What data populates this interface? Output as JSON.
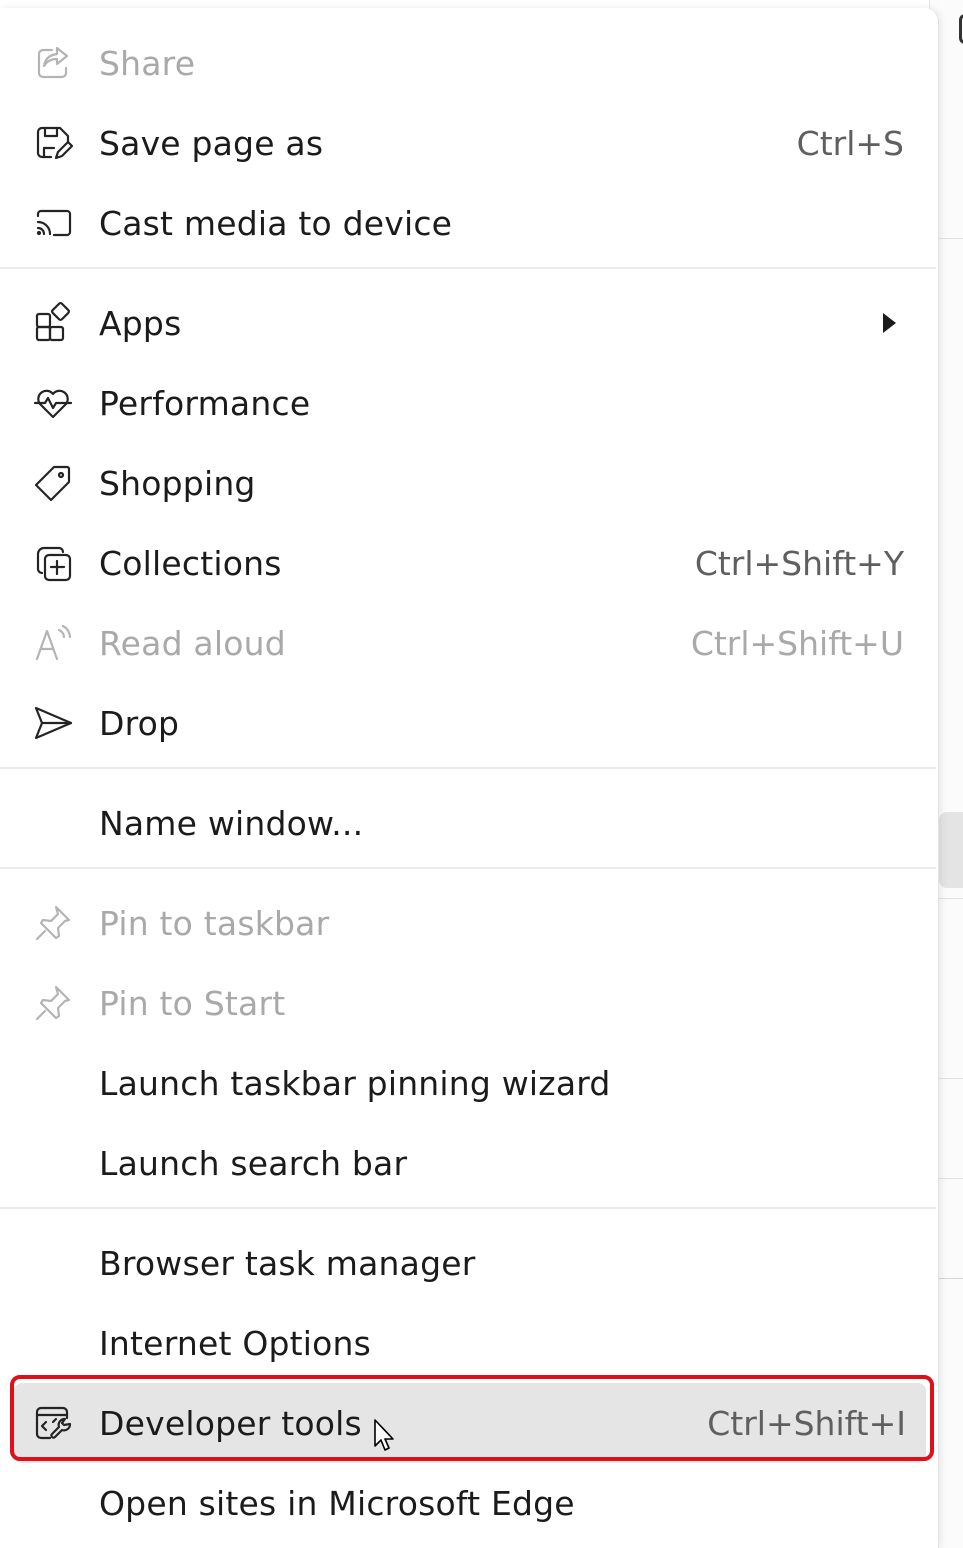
{
  "menu": {
    "items": [
      {
        "id": "share",
        "label": "Share",
        "shortcut": "",
        "icon": "share-icon",
        "disabled": true
      },
      {
        "id": "save-page-as",
        "label": "Save page as",
        "shortcut": "Ctrl+S",
        "icon": "save-icon",
        "disabled": false
      },
      {
        "id": "cast-media",
        "label": "Cast media to device",
        "shortcut": "",
        "icon": "cast-icon",
        "disabled": false
      },
      {
        "id": "apps",
        "label": "Apps",
        "shortcut": "",
        "icon": "apps-icon",
        "disabled": false,
        "submenu": true
      },
      {
        "id": "performance",
        "label": "Performance",
        "shortcut": "",
        "icon": "heartbeat-icon",
        "disabled": false
      },
      {
        "id": "shopping",
        "label": "Shopping",
        "shortcut": "",
        "icon": "tag-icon",
        "disabled": false
      },
      {
        "id": "collections",
        "label": "Collections",
        "shortcut": "Ctrl+Shift+Y",
        "icon": "collections-icon",
        "disabled": false
      },
      {
        "id": "read-aloud",
        "label": "Read aloud",
        "shortcut": "Ctrl+Shift+U",
        "icon": "read-aloud-icon",
        "disabled": true
      },
      {
        "id": "drop",
        "label": "Drop",
        "shortcut": "",
        "icon": "send-icon",
        "disabled": false
      },
      {
        "id": "name-window",
        "label": "Name window...",
        "shortcut": "",
        "icon": "",
        "disabled": false
      },
      {
        "id": "pin-taskbar",
        "label": "Pin to taskbar",
        "shortcut": "",
        "icon": "pin-icon",
        "disabled": true
      },
      {
        "id": "pin-start",
        "label": "Pin to Start",
        "shortcut": "",
        "icon": "pin-icon",
        "disabled": true
      },
      {
        "id": "launch-wizard",
        "label": "Launch taskbar pinning wizard",
        "shortcut": "",
        "icon": "",
        "disabled": false
      },
      {
        "id": "launch-search",
        "label": "Launch search bar",
        "shortcut": "",
        "icon": "",
        "disabled": false
      },
      {
        "id": "task-manager",
        "label": "Browser task manager",
        "shortcut": "",
        "icon": "",
        "disabled": false
      },
      {
        "id": "internet-options",
        "label": "Internet Options",
        "shortcut": "",
        "icon": "",
        "disabled": false
      },
      {
        "id": "developer-tools",
        "label": "Developer tools",
        "shortcut": "Ctrl+Shift+I",
        "icon": "developer-tools-icon",
        "disabled": false,
        "highlighted": true
      },
      {
        "id": "open-in-edge",
        "label": "Open sites in Microsoft Edge",
        "shortcut": "",
        "icon": "",
        "disabled": false
      }
    ]
  },
  "colors": {
    "highlight_border": "#e0101a",
    "hover_background": "#e5e5e5",
    "disabled_text": "#a9a9a9"
  }
}
